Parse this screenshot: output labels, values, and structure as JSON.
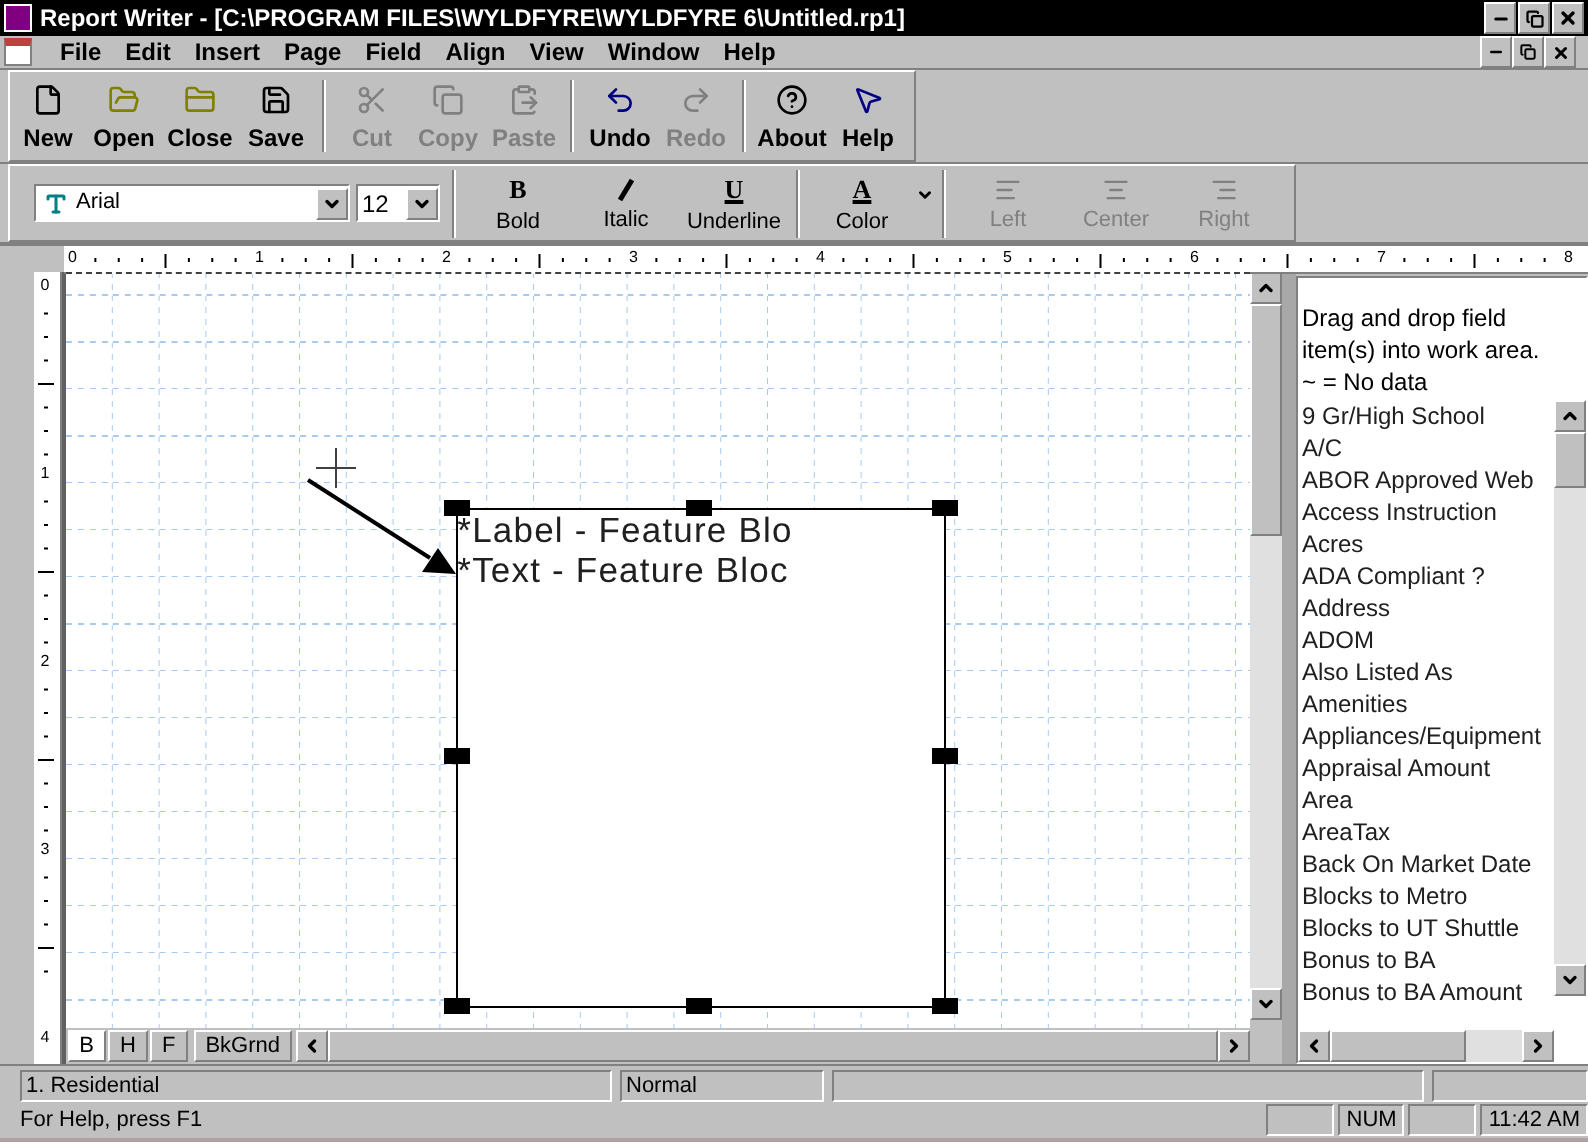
{
  "window": {
    "title": "Report Writer - [C:\\PROGRAM FILES\\WYLDFYRE\\WYLDFYRE 6\\Untitled.rp1]"
  },
  "menu": [
    "File",
    "Edit",
    "Insert",
    "Page",
    "Field",
    "Align",
    "View",
    "Window",
    "Help"
  ],
  "toolbar": [
    {
      "kind": "new",
      "label": "New",
      "disabled": false
    },
    {
      "kind": "open",
      "label": "Open",
      "disabled": false
    },
    {
      "kind": "close",
      "label": "Close",
      "disabled": false
    },
    {
      "kind": "save",
      "label": "Save",
      "disabled": false
    },
    {
      "kind": "sep"
    },
    {
      "kind": "cut",
      "label": "Cut",
      "disabled": true
    },
    {
      "kind": "copy",
      "label": "Copy",
      "disabled": true
    },
    {
      "kind": "paste",
      "label": "Paste",
      "disabled": true
    },
    {
      "kind": "sep"
    },
    {
      "kind": "undo",
      "label": "Undo",
      "disabled": false
    },
    {
      "kind": "redo",
      "label": "Redo",
      "disabled": true
    },
    {
      "kind": "sep"
    },
    {
      "kind": "about",
      "label": "About",
      "disabled": false
    },
    {
      "kind": "help",
      "label": "Help",
      "disabled": false
    }
  ],
  "format_bar": {
    "font": "Arial",
    "size": "12",
    "buttons": [
      {
        "kind": "bold",
        "glyph": "B",
        "label": "Bold",
        "disabled": false
      },
      {
        "kind": "italic",
        "label": "Italic",
        "disabled": false
      },
      {
        "kind": "underline",
        "glyph": "U",
        "label": "Underline",
        "disabled": false
      },
      {
        "kind": "sep"
      },
      {
        "kind": "color",
        "glyph": "A",
        "label": "Color",
        "disabled": false
      },
      {
        "kind": "sep"
      },
      {
        "kind": "left",
        "label": "Left",
        "disabled": true
      },
      {
        "kind": "center",
        "label": "Center",
        "disabled": true
      },
      {
        "kind": "right",
        "label": "Right",
        "disabled": true
      }
    ]
  },
  "ruler": {
    "horizontal": [
      "0",
      "1",
      "2",
      "3",
      "4",
      "5",
      "6",
      "7",
      "8"
    ],
    "vertical": [
      "0",
      "1",
      "2",
      "3",
      "4"
    ]
  },
  "frame": {
    "lines": [
      "*Label - Feature Blo",
      "*Text - Feature Bloc"
    ]
  },
  "section_tabs": [
    {
      "label": "B",
      "selected": true
    },
    {
      "label": "H",
      "selected": false
    },
    {
      "label": "F",
      "selected": false
    },
    {
      "label": "BkGrnd",
      "selected": false
    }
  ],
  "field_panel": {
    "instructions": [
      "Drag and drop field",
      "item(s) into work area.",
      "~ = No data"
    ],
    "fields": [
      "9 Gr/High School",
      "A/C",
      "ABOR Approved Web",
      "Access Instruction",
      "Acres",
      "ADA Compliant ?",
      "Address",
      "ADOM",
      "Also Listed As",
      "Amenities",
      "Appliances/Equipment",
      "Appraisal Amount",
      "Area",
      "AreaTax",
      "Back On Market Date",
      "Blocks to Metro",
      "Blocks to UT Shuttle",
      "Bonus to BA",
      "Bonus to BA Amount"
    ]
  },
  "info_bar": [
    "1. Residential",
    "Normal"
  ],
  "status_bar": {
    "message": "For Help, press F1",
    "indicators": [
      "NUM",
      "11:42 AM"
    ]
  }
}
